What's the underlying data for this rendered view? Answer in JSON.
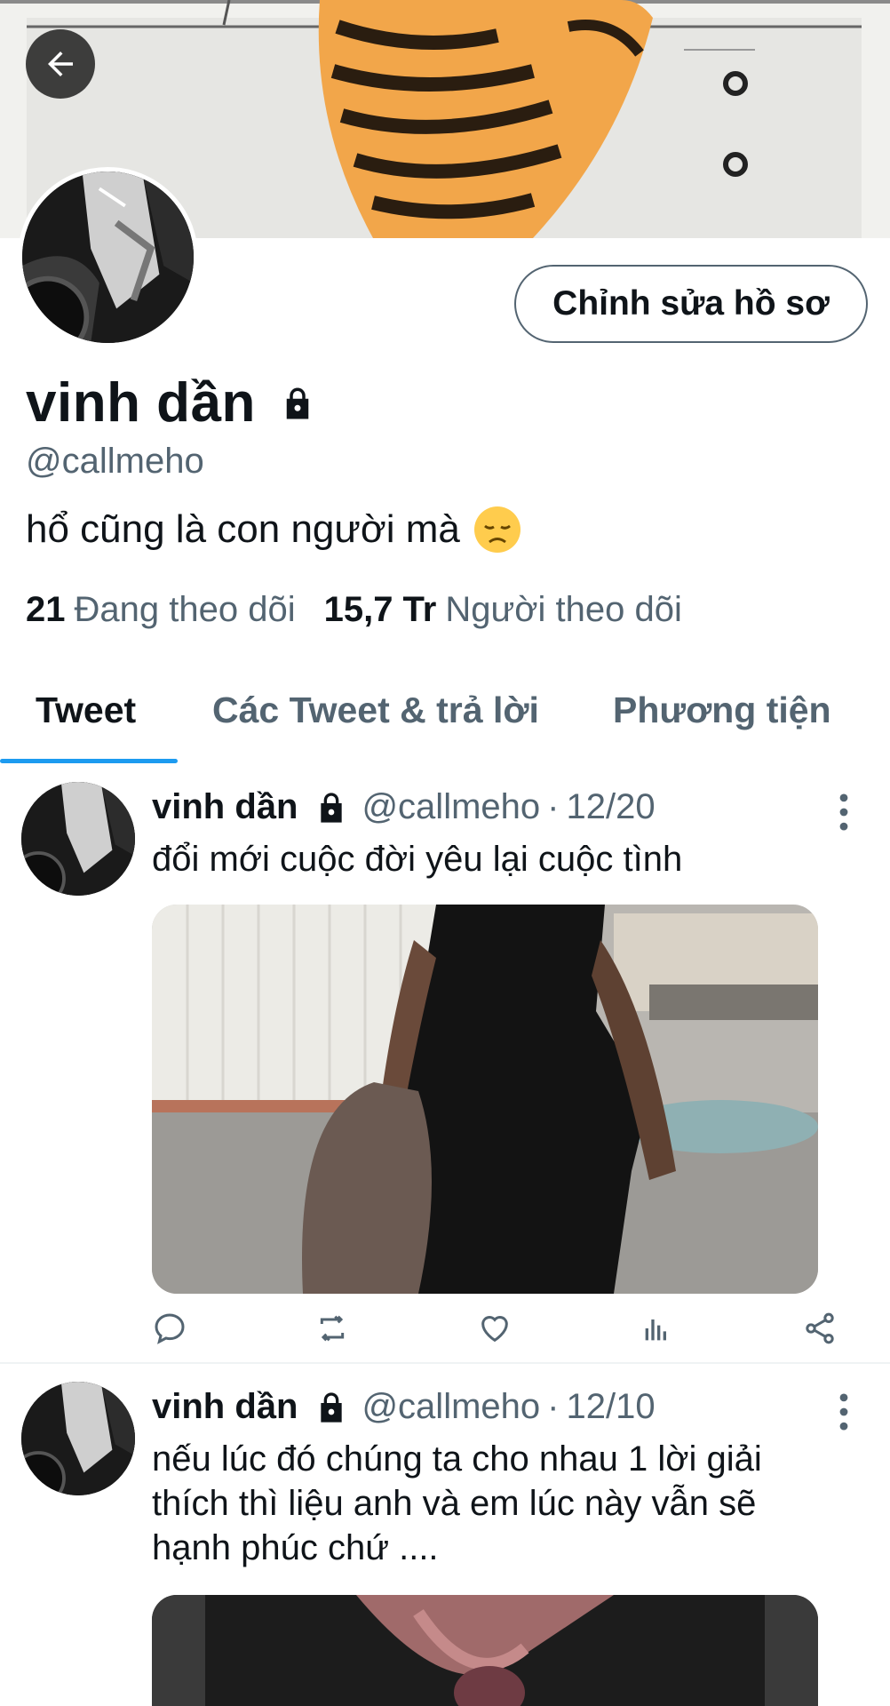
{
  "profile": {
    "name": "vinh dần",
    "handle": "@callmeho",
    "bio": "hổ cũng là con người mà",
    "edit_button_label": "Chỉnh sửa hồ sơ",
    "following_count": "21",
    "following_label": "Đang theo dõi",
    "followers_count": "15,7 Tr",
    "followers_label": "Người theo dõi"
  },
  "tabs": [
    {
      "label": "Tweet",
      "active": true
    },
    {
      "label": "Các Tweet & trả lời",
      "active": false
    },
    {
      "label": "Phương tiện",
      "active": false
    }
  ],
  "tweets": [
    {
      "name": "vinh dần",
      "handle": "@callmeho",
      "separator": "·",
      "date": "12/20",
      "text": "đổi mới cuộc đời yêu lại cuộc tình"
    },
    {
      "name": "vinh dần",
      "handle": "@callmeho",
      "separator": "·",
      "date": "12/10",
      "text": "nếu lúc đó chúng ta cho nhau 1 lời giải thích thì liệu anh và em lúc này vẫn sẽ hạnh phúc chứ ...."
    }
  ],
  "icons": {
    "back": "arrow-left-icon",
    "lock": "lock-icon",
    "emoji": "disappointed-face-emoji",
    "more": "more-vertical-icon",
    "reply": "reply-icon",
    "retweet": "retweet-icon",
    "like": "heart-icon",
    "analytics": "analytics-icon",
    "share": "share-icon"
  },
  "colors": {
    "accent": "#1d9bf0",
    "text_primary": "#0f1419",
    "text_secondary": "#536471"
  }
}
